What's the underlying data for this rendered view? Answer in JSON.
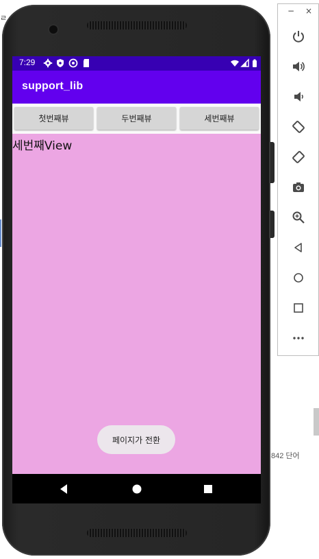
{
  "background": {
    "left_fragment": "ㄹ",
    "word_count": "842 단어"
  },
  "status_bar": {
    "time": "7:29",
    "left_icons": [
      "settings-icon",
      "shield-icon",
      "vpn-icon",
      "sd-card-icon"
    ],
    "right_icons": [
      "wifi-icon",
      "signal-icon",
      "battery-icon"
    ]
  },
  "app_bar": {
    "title": "support_lib"
  },
  "tabs": [
    {
      "label": "첫번째뷰"
    },
    {
      "label": "두번째뷰"
    },
    {
      "label": "세번째뷰"
    }
  ],
  "content": {
    "text": "세번째View",
    "background_color": "#eca6e3"
  },
  "toast": {
    "text": "페이지가 전환"
  },
  "nav_bar": {
    "buttons": [
      "back-icon",
      "home-icon",
      "recents-icon"
    ]
  },
  "emulator_panel": {
    "window_buttons": [
      "−",
      "×"
    ],
    "buttons": [
      "power-icon",
      "volume-up-icon",
      "volume-down-icon",
      "rotate-left-icon",
      "rotate-right-icon",
      "camera-icon",
      "zoom-icon",
      "back-icon",
      "home-icon",
      "overview-icon",
      "more-icon"
    ]
  },
  "colors": {
    "status_bar": "#3700b3",
    "app_bar": "#6200ee",
    "tab_button": "#d6d6d6",
    "toast": "#ece6ec"
  }
}
